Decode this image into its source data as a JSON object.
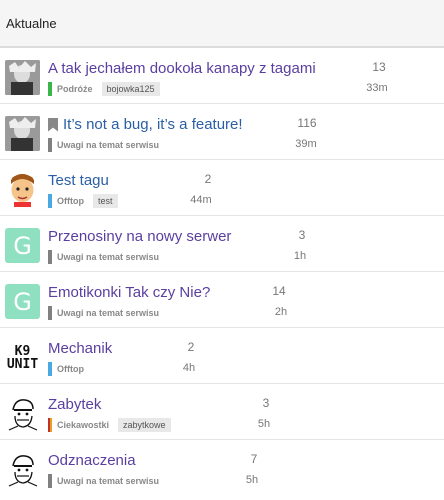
{
  "header": {
    "title": "Aktualne"
  },
  "topics": [
    {
      "title": "A tak jechałem dookoła kanapy z tagami",
      "visited": false,
      "bookmarked": false,
      "category": "Podróże",
      "category_color": "#3ab54a",
      "tag": "bojowka125",
      "replies": "13",
      "activity": "33m",
      "avatar": "photo",
      "avatar_letter": ""
    },
    {
      "title": "It’s not a bug, it’s a feature!",
      "visited": true,
      "bookmarked": true,
      "category": "Uwagi na temat serwisu",
      "category_color": "#808080",
      "tag": "",
      "replies": "116",
      "activity": "39m",
      "avatar": "photo",
      "avatar_letter": ""
    },
    {
      "title": "Test tagu",
      "visited": true,
      "bookmarked": false,
      "category": "Offtop",
      "category_color": "#4aa9e0",
      "tag": "test",
      "replies": "2",
      "activity": "44m",
      "avatar": "cartoon",
      "avatar_letter": ""
    },
    {
      "title": "Przenosiny na nowy serwer",
      "visited": false,
      "bookmarked": false,
      "category": "Uwagi na temat serwisu",
      "category_color": "#808080",
      "tag": "",
      "replies": "3",
      "activity": "1h",
      "avatar": "letter",
      "avatar_letter": "G"
    },
    {
      "title": "Emotikonki Tak czy Nie?",
      "visited": false,
      "bookmarked": false,
      "category": "Uwagi na temat serwisu",
      "category_color": "#808080",
      "tag": "",
      "replies": "14",
      "activity": "2h",
      "avatar": "letter",
      "avatar_letter": "G"
    },
    {
      "title": "Mechanik",
      "visited": false,
      "bookmarked": false,
      "category": "Offtop",
      "category_color": "#4aa9e0",
      "tag": "",
      "replies": "2",
      "activity": "4h",
      "avatar": "k9",
      "avatar_letter": "K9 UNIT"
    },
    {
      "title": "Zabytek",
      "visited": false,
      "bookmarked": false,
      "category": "Ciekawostki",
      "category_color": "#c0302c",
      "tag": "zabytkowe",
      "replies": "3",
      "activity": "5h",
      "avatar": "meme",
      "avatar_letter": ""
    },
    {
      "title": "Odznaczenia",
      "visited": false,
      "bookmarked": false,
      "category": "Uwagi na temat serwisu",
      "category_color": "#808080",
      "tag": "",
      "replies": "7",
      "activity": "5h",
      "avatar": "meme",
      "avatar_letter": ""
    }
  ]
}
